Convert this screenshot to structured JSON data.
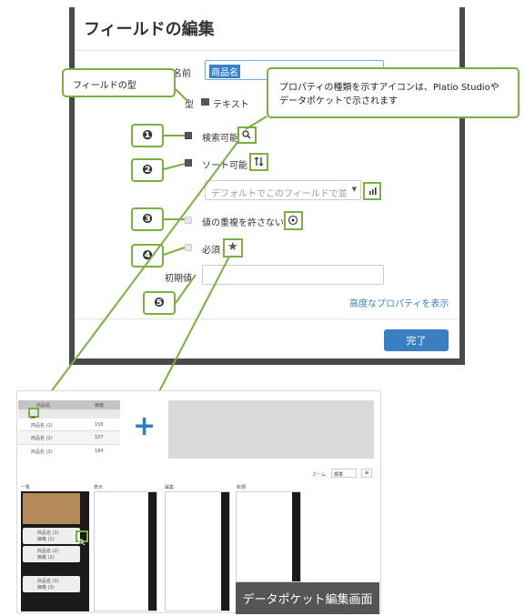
{
  "dialog": {
    "title": "フィールドの編集",
    "name_label": "名前",
    "name_value": "商品名",
    "type_label": "型",
    "type_value": "テキスト",
    "searchable_label": "検索可能",
    "sortable_label": "ソート可能",
    "default_sort_placeholder": "デフォルトでこのフィールドで並",
    "unique_label": "値の重複を許さない",
    "required_label": "必須",
    "initial_label": "初期値",
    "advanced_link": "高度なプロパティを表示",
    "done_button": "完了"
  },
  "callouts": {
    "field_type": "フィールドの型",
    "icon_note": "プロパティの種類を示すアイコンは、Platio Studioやデータポケットで示されます"
  },
  "badges": [
    "❶",
    "❷",
    "❸",
    "❹",
    "❺"
  ],
  "icons": {
    "search": "search-icon",
    "sort": "sort-icon",
    "bar_chart": "bar-chart-icon",
    "unique": "unique-icon",
    "star": "star-icon"
  },
  "pocket": {
    "caption": "データポケット編集画面",
    "header_cols": [
      "商品名",
      "価格"
    ],
    "rows": [
      {
        "name": "商品名 (1)",
        "value": "156"
      },
      {
        "name": "商品名 (2)",
        "value": "107"
      },
      {
        "name": "商品名 (3)",
        "value": "184"
      }
    ],
    "zoom_label": "ズーム",
    "zoom_value": "標準",
    "panel_titles": [
      "一覧",
      "表示",
      "編集",
      "新規"
    ],
    "list_items": [
      {
        "title": "商品名 (1)",
        "sub": "価格 (1)"
      },
      {
        "title": "商品名 (2)",
        "sub": "価格 (2)"
      },
      {
        "title": "商品名 (3)",
        "sub": "価格 (3)"
      }
    ]
  },
  "colors": {
    "accent_green": "#79b03f",
    "button_blue": "#3a7fc1",
    "plus_blue": "#2d7cc4"
  }
}
